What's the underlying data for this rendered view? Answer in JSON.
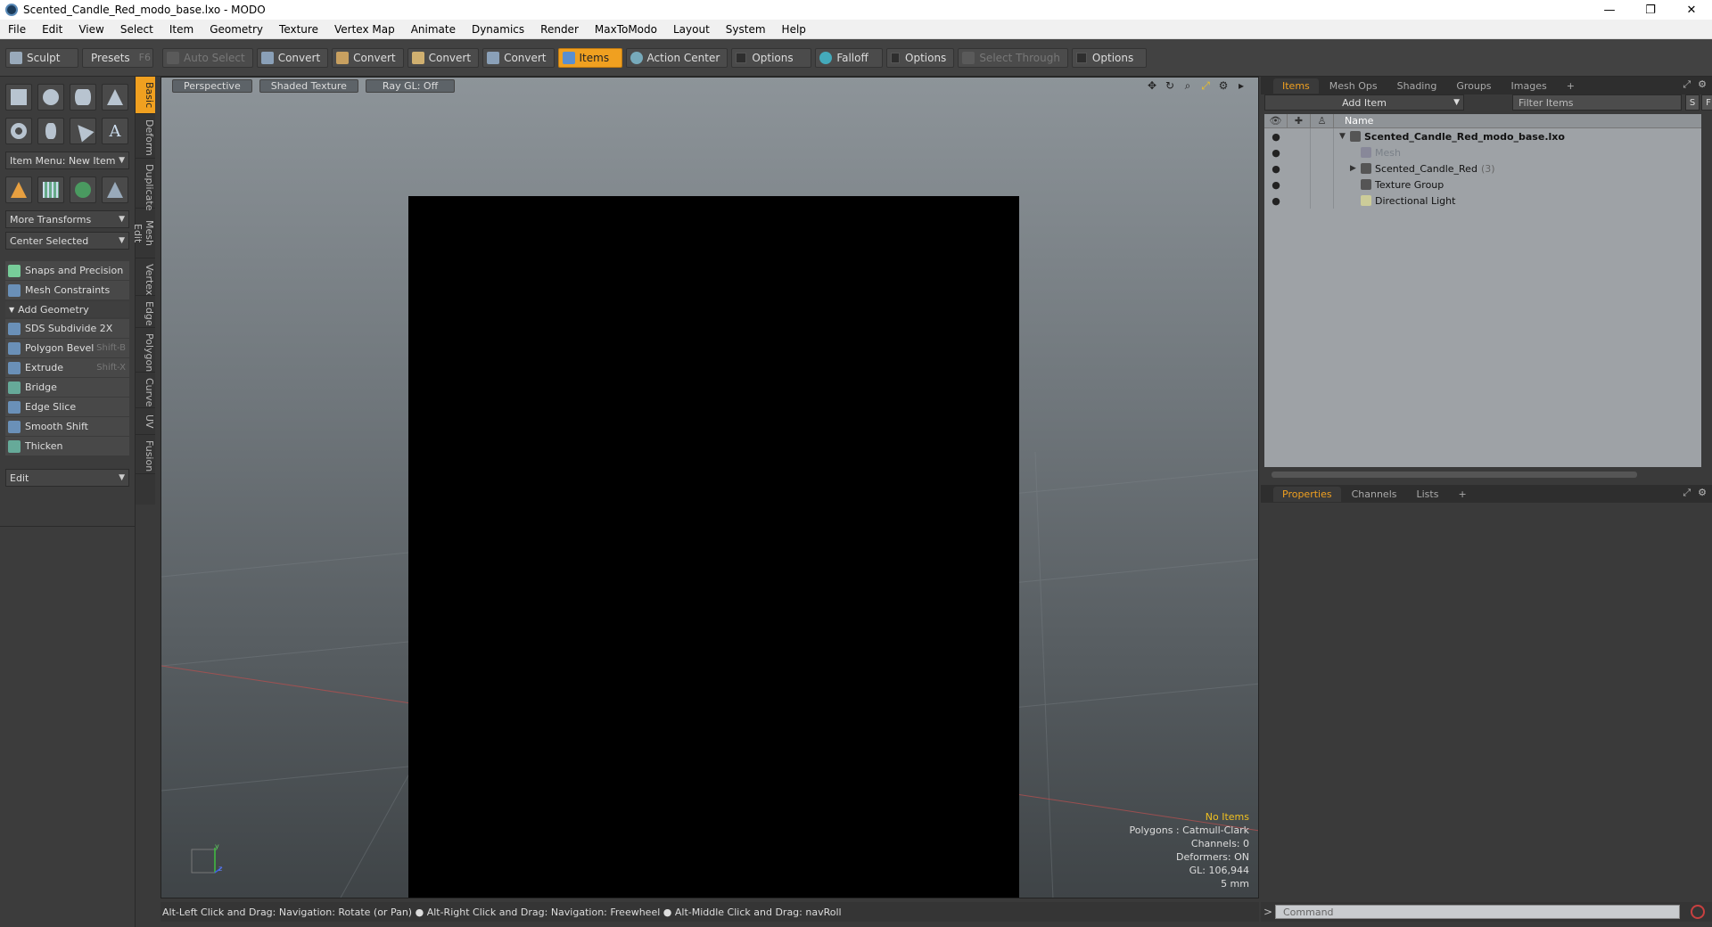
{
  "window": {
    "title": "Scented_Candle_Red_modo_base.lxo - MODO",
    "controls": [
      "—",
      "❐",
      "✕"
    ]
  },
  "menu": [
    "File",
    "Edit",
    "View",
    "Select",
    "Item",
    "Geometry",
    "Texture",
    "Vertex Map",
    "Animate",
    "Dynamics",
    "Render",
    "MaxToModo",
    "Layout",
    "System",
    "Help"
  ],
  "toolbar": {
    "sculpt": "Sculpt",
    "presets": "Presets",
    "presets_key": "F6",
    "auto_select": "Auto Select",
    "convert1": "Convert",
    "convert2": "Convert",
    "convert3": "Convert",
    "convert4": "Convert",
    "items": "Items",
    "action_center": "Action Center",
    "options1": "Options",
    "falloff": "Falloff",
    "options2": "Options",
    "select_through": "Select Through",
    "options3": "Options"
  },
  "left": {
    "item_menu": "Item Menu: New Item",
    "more_transforms": "More Transforms",
    "center_selected": "Center Selected",
    "snaps": "Snaps and Precision",
    "constraints": "Mesh Constraints",
    "add_geometry": "Add Geometry",
    "tools": [
      {
        "label": "SDS Subdivide 2X",
        "key": ""
      },
      {
        "label": "Polygon Bevel",
        "key": "Shift-B"
      },
      {
        "label": "Extrude",
        "key": "Shift-X"
      },
      {
        "label": "Bridge",
        "key": ""
      },
      {
        "label": "Edge Slice",
        "key": ""
      },
      {
        "label": "Smooth Shift",
        "key": ""
      },
      {
        "label": "Thicken",
        "key": ""
      }
    ],
    "edit": "Edit",
    "vtabs": [
      "Basic",
      "Deform",
      "Duplicate",
      "Mesh Edit",
      "Vertex",
      "Edge",
      "Polygon",
      "Curve",
      "UV",
      "Fusion"
    ]
  },
  "viewport": {
    "perspective": "Perspective",
    "shading": "Shaded Texture",
    "raygl": "Ray GL: Off",
    "stats": {
      "items": "No Items",
      "polygons": "Polygons : Catmull-Clark",
      "channels": "Channels: 0",
      "deformers": "Deformers: ON",
      "gl": "GL: 106,944",
      "unit": "5 mm"
    },
    "axis_y": "y",
    "axis_z": "z"
  },
  "status": "Alt-Left Click and Drag: Navigation: Rotate (or Pan) ● Alt-Right Click and Drag: Navigation: Freewheel ● Alt-Middle Click and Drag: navRoll",
  "items_panel": {
    "tabs": [
      "Items",
      "Mesh Ops",
      "Shading",
      "Groups",
      "Images",
      "+"
    ],
    "add_item": "Add Item",
    "filter": "Filter Items",
    "s_btn": "S",
    "f_btn": "F",
    "name_col": "Name",
    "rows": [
      {
        "name": "Scented_Candle_Red_modo_base.lxo",
        "count": ""
      },
      {
        "name": "Mesh",
        "count": ""
      },
      {
        "name": "Scented_Candle_Red",
        "count": "(3)"
      },
      {
        "name": "Texture Group",
        "count": ""
      },
      {
        "name": "Directional Light",
        "count": ""
      }
    ]
  },
  "props_panel": {
    "tabs": [
      "Properties",
      "Channels",
      "Lists",
      "+"
    ]
  },
  "command": {
    "prompt": ">",
    "placeholder": "Command"
  },
  "colors": {
    "accent": "#f0a020",
    "bg": "#3a3a3a",
    "viewport_top": "#8d9499"
  }
}
